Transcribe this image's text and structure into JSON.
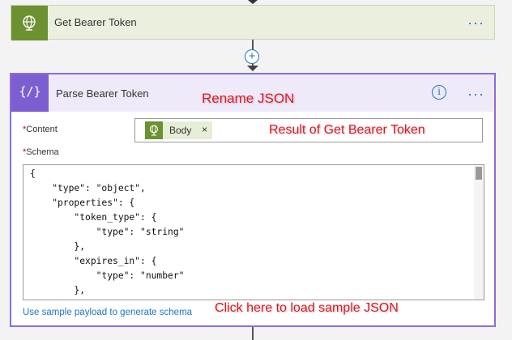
{
  "steps": {
    "get_token": {
      "title": "Get Bearer Token",
      "more": "···"
    },
    "insert_step": {
      "symbol": "+"
    },
    "parse": {
      "icon_text": "{/}",
      "title": "Parse Bearer Token",
      "info": "i",
      "more": "···",
      "content_label": "Content",
      "content_token": "Body",
      "token_remove": "×",
      "schema_label": "Schema",
      "required_marker": "*",
      "schema_text": "{\n    \"type\": \"object\",\n    \"properties\": {\n        \"token_type\": {\n            \"type\": \"string\"\n        },\n        \"expires_in\": {\n            \"type\": \"number\"\n        },\n        \"ext_expires_in\": {",
      "sample_link": "Use sample payload to generate schema"
    }
  },
  "annotations": {
    "rename": "Rename JSON",
    "result": "Result of Get Bearer Token",
    "click": "Click here to load sample JSON"
  },
  "colors": {
    "http_green": "#6b9130",
    "parse_purple": "#7b5fd1",
    "link_blue": "#1f74c8",
    "annotation_red": "#e0141e"
  },
  "icons": [
    "globe-icon",
    "braces-icon",
    "info-icon",
    "more-icon",
    "plus-icon",
    "close-icon"
  ]
}
